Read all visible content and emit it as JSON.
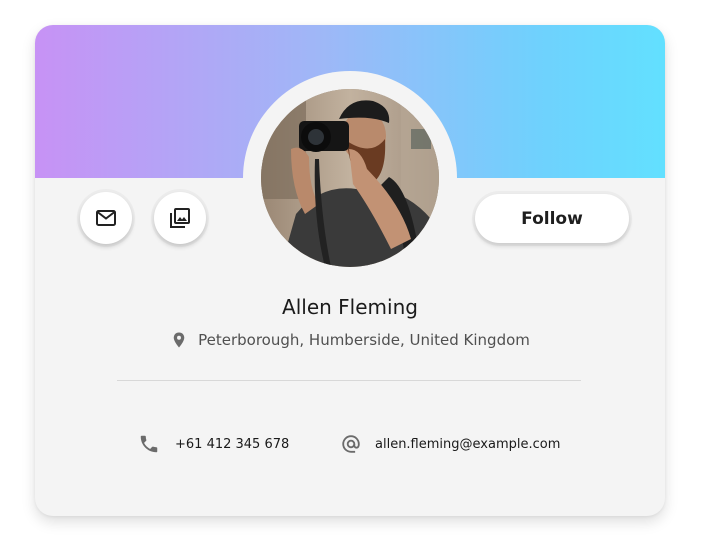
{
  "profile": {
    "name": "Allen Fleming",
    "location": "Peterborough, Humberside, United Kingdom",
    "phone": "+61 412 345 678",
    "email": "allen.fleming@example.com"
  },
  "actions": {
    "follow_label": "Follow",
    "mail_icon": "mail-icon",
    "gallery_icon": "photo-library-icon"
  },
  "colors": {
    "banner_gradient_start": "#c792f5",
    "banner_gradient_end": "#62e0ff",
    "card_background": "#f4f4f4",
    "icon_gray": "#6b6b6b"
  }
}
